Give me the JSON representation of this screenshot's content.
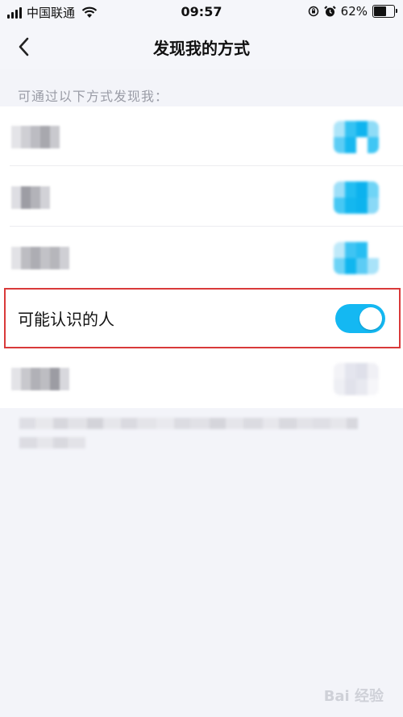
{
  "status_bar": {
    "carrier": "中国联通",
    "time": "09:57",
    "battery_percent": "62%",
    "battery_level": 0.62,
    "icons": [
      "signal-icon",
      "wifi-icon",
      "orientation-lock-icon",
      "alarm-icon",
      "battery-icon"
    ]
  },
  "nav": {
    "title": "发现我的方式",
    "back_icon": "chevron-left-icon"
  },
  "section": {
    "label": "可通过以下方式发现我："
  },
  "rows": {
    "highlighted": {
      "label": "可能认识的人",
      "toggle_on": true
    }
  },
  "colors": {
    "accent": "#14b8f2",
    "highlight_border": "#d93a3a",
    "background": "#f3f4f9"
  },
  "watermark": {
    "text": "Bai 经验"
  }
}
